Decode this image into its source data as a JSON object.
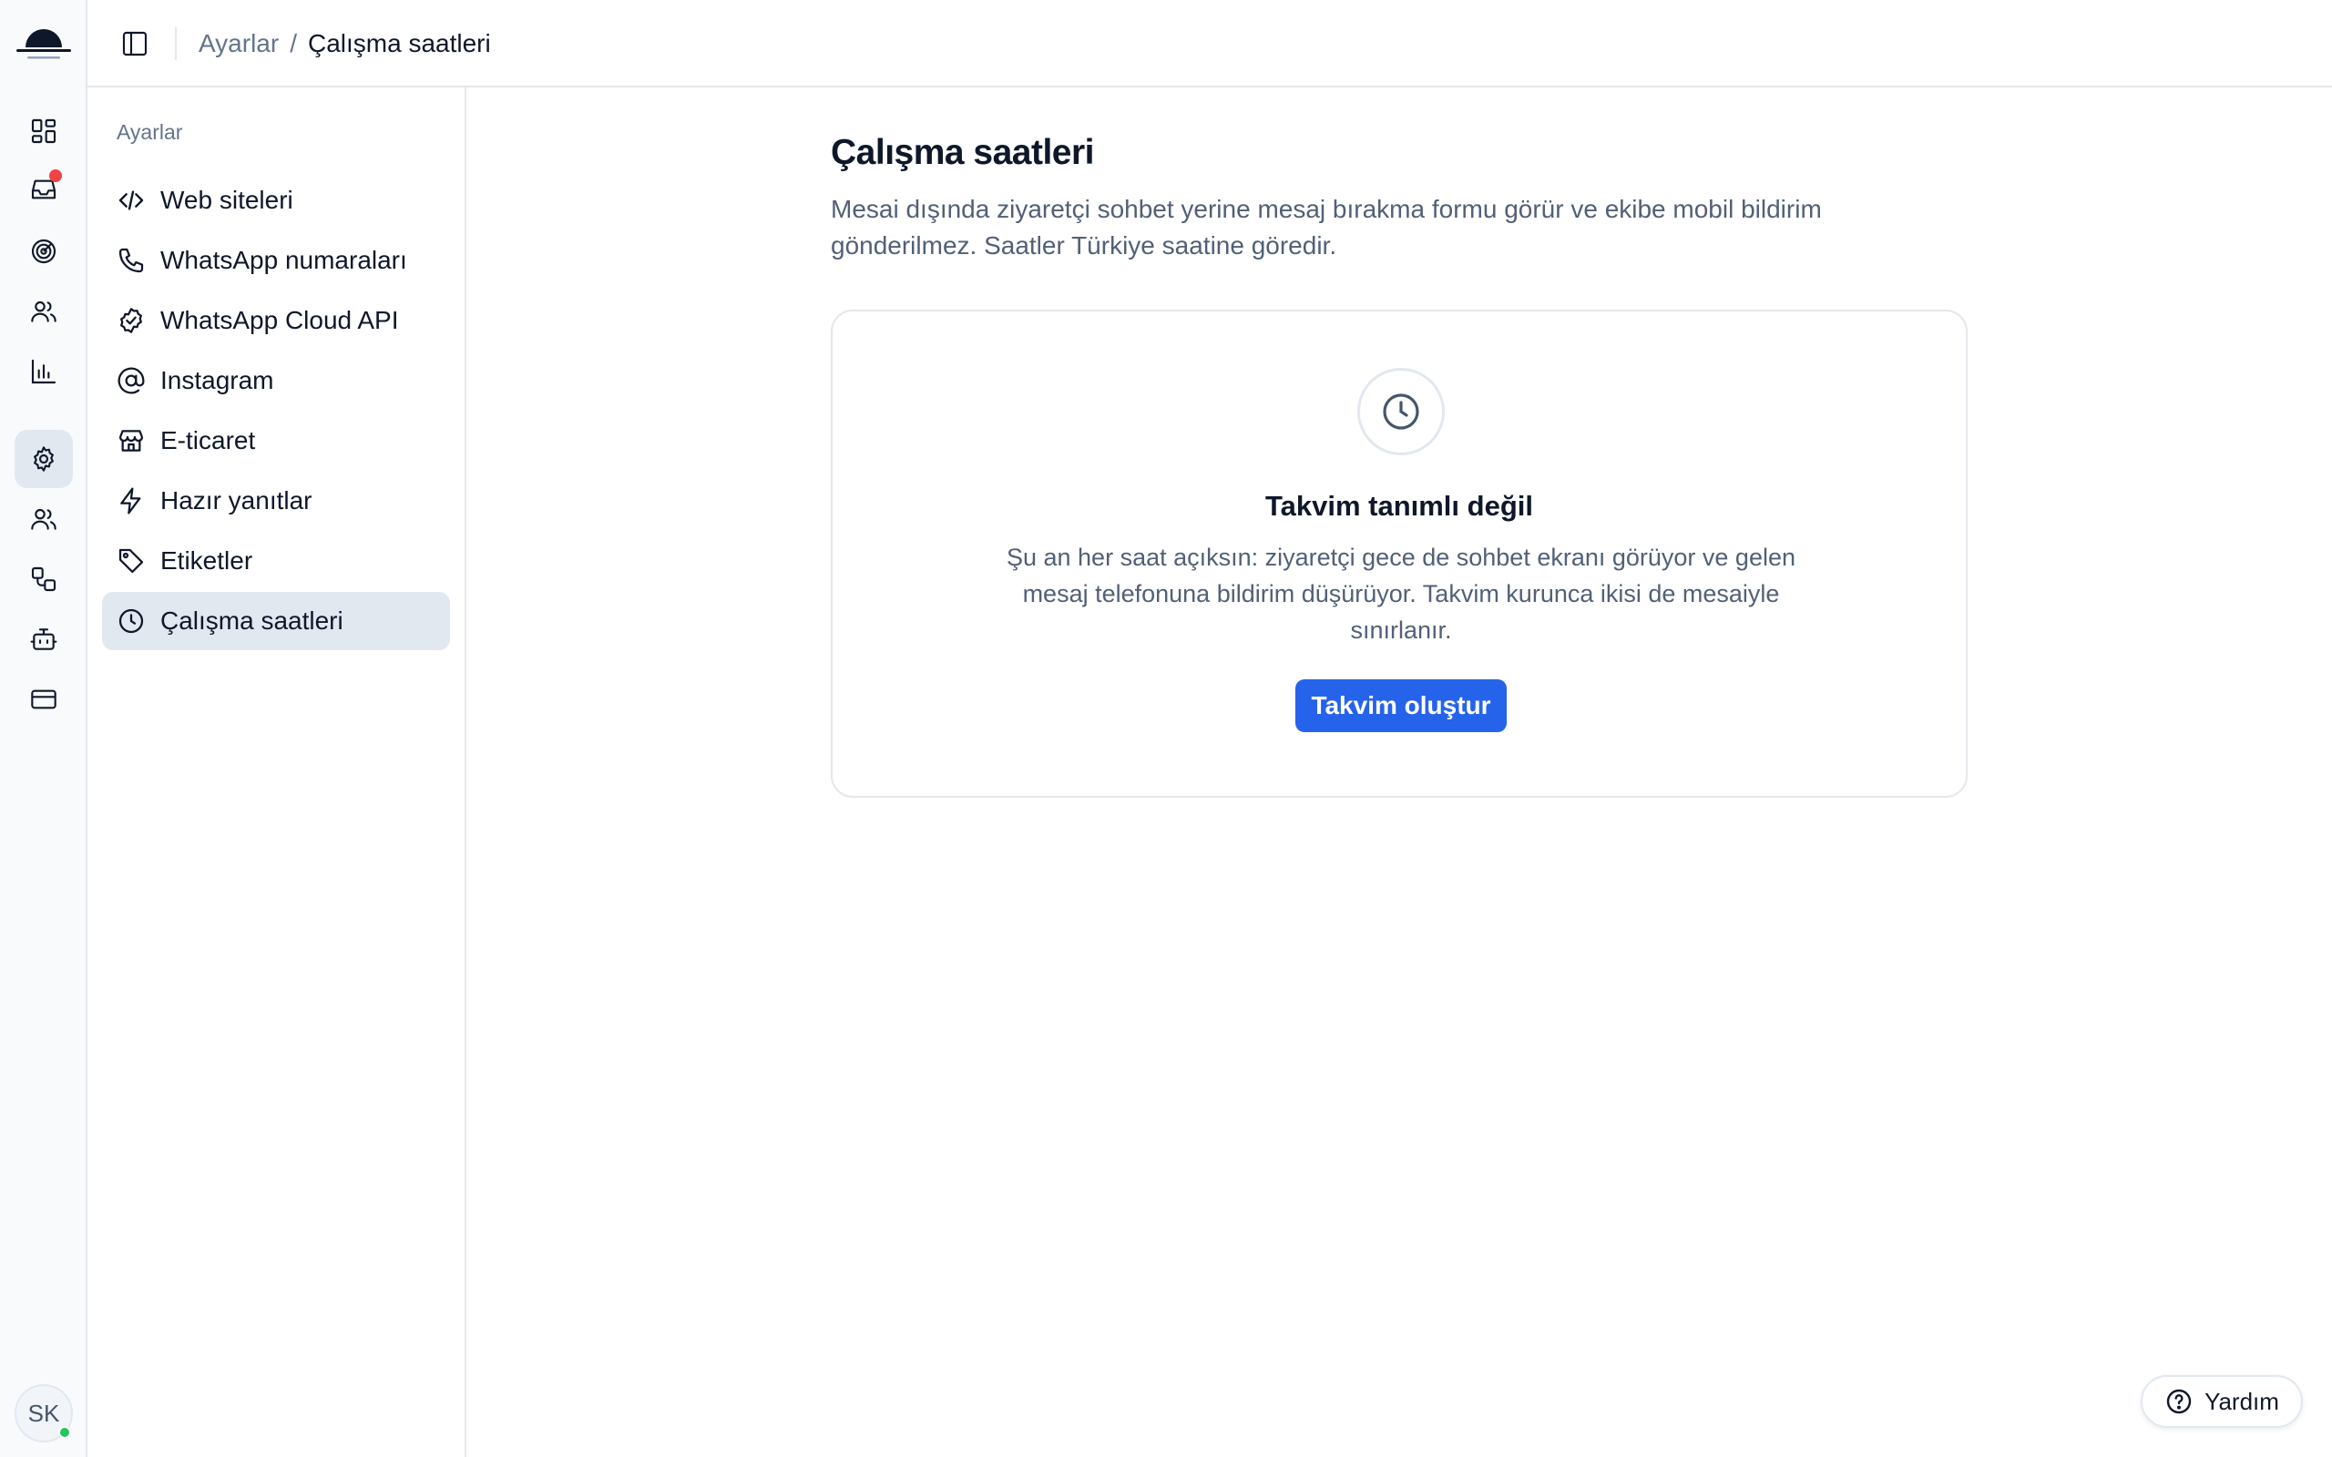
{
  "breadcrumb": {
    "parent": "Ayarlar",
    "separator": "/",
    "current": "Çalışma saatleri"
  },
  "rail": {
    "items": [
      {
        "icon": "dashboard-icon"
      },
      {
        "icon": "inbox-icon",
        "has_notification": true
      },
      {
        "icon": "target-icon"
      },
      {
        "icon": "contacts-icon"
      },
      {
        "icon": "analytics-icon"
      },
      {
        "icon": "gear-icon",
        "active": true
      },
      {
        "icon": "team-icon"
      },
      {
        "icon": "workflow-icon"
      },
      {
        "icon": "bot-icon"
      },
      {
        "icon": "billing-icon"
      }
    ],
    "avatar_initials": "SK",
    "status_color": "#22c55e",
    "notification_color": "#ef4444"
  },
  "settings_nav": {
    "heading": "Ayarlar",
    "items": [
      {
        "label": "Web siteleri",
        "icon": "code-icon"
      },
      {
        "label": "WhatsApp numaraları",
        "icon": "phone-icon"
      },
      {
        "label": "WhatsApp Cloud API",
        "icon": "check-badge-icon"
      },
      {
        "label": "Instagram",
        "icon": "at-sign-icon"
      },
      {
        "label": "E-ticaret",
        "icon": "store-icon"
      },
      {
        "label": "Hazır yanıtlar",
        "icon": "lightning-icon"
      },
      {
        "label": "Etiketler",
        "icon": "tag-icon"
      },
      {
        "label": "Çalışma saatleri",
        "icon": "clock-icon",
        "active": true
      }
    ]
  },
  "main": {
    "title": "Çalışma saatleri",
    "description": "Mesai dışında ziyaretçi sohbet yerine mesaj bırakma formu görür ve ekibe mobil bildirim gönderilmez. Saatler Türkiye saatine göredir.",
    "empty_state": {
      "icon": "clock-icon",
      "title": "Takvim tanımlı değil",
      "description": "Şu an her saat açıksın: ziyaretçi gece de sohbet ekranı görüyor ve gelen mesaj telefonuna bildirim düşürüyor. Takvim kurunca ikisi de mesaiyle sınırlanır.",
      "button_label": "Takvim oluştur"
    }
  },
  "help": {
    "label": "Yardım",
    "icon": "help-circle-icon"
  },
  "colors": {
    "primary": "#2563eb",
    "text": "#0f172a",
    "muted": "#526077",
    "border": "#e5e7eb",
    "active_bg": "#e2e8f0"
  }
}
